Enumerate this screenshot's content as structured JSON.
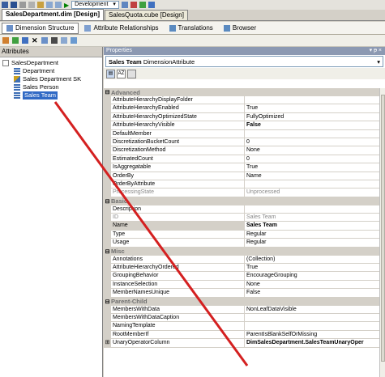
{
  "toolbar": {
    "config_combo": "Development",
    "accent": "#008000"
  },
  "doc_tabs": [
    {
      "label": "SalesDepartment.dim [Design]",
      "active": true
    },
    {
      "label": "SalesQuota.cube [Design]",
      "active": false
    }
  ],
  "design_tabs": [
    {
      "label": "Dimension Structure",
      "active": true
    },
    {
      "label": "Attribute Relationships",
      "active": false
    },
    {
      "label": "Translations",
      "active": false
    },
    {
      "label": "Browser",
      "active": false
    }
  ],
  "attributes_pane": {
    "title": "Attributes",
    "root": "SalesDepartment",
    "items": [
      {
        "label": "Department",
        "selected": false
      },
      {
        "label": "Sales Department SK",
        "selected": false
      },
      {
        "label": "Sales Person",
        "selected": false
      },
      {
        "label": "Sales Team",
        "selected": true
      }
    ]
  },
  "properties": {
    "title": "Properties",
    "pin_glyph": "▾ ᵽ ×",
    "object_name": "Sales Team",
    "object_type": "DimensionAttribute",
    "categories": [
      {
        "name": "Advanced",
        "rows": [
          {
            "name": "AttributeHierarchyDisplayFolder",
            "value": ""
          },
          {
            "name": "AttributeHierarchyEnabled",
            "value": "True"
          },
          {
            "name": "AttributeHierarchyOptimizedState",
            "value": "FullyOptimized"
          },
          {
            "name": "AttributeHierarchyVisible",
            "value": "False",
            "bold": true
          },
          {
            "name": "DefaultMember",
            "value": ""
          },
          {
            "name": "DiscretizationBucketCount",
            "value": "0"
          },
          {
            "name": "DiscretizationMethod",
            "value": "None"
          },
          {
            "name": "EstimatedCount",
            "value": "0"
          },
          {
            "name": "IsAggregatable",
            "value": "True"
          },
          {
            "name": "OrderBy",
            "value": "Name"
          },
          {
            "name": "OrderByAttribute",
            "value": ""
          },
          {
            "name": "ProcessingState",
            "value": "Unprocessed",
            "grey": true
          }
        ]
      },
      {
        "name": "Basic",
        "rows": [
          {
            "name": "Description",
            "value": ""
          },
          {
            "name": "ID",
            "value": "Sales Team",
            "grey": true
          },
          {
            "name": "Name",
            "value": "Sales Team",
            "bold": true,
            "selected": true
          },
          {
            "name": "Type",
            "value": "Regular"
          },
          {
            "name": "Usage",
            "value": "Regular"
          }
        ]
      },
      {
        "name": "Misc",
        "rows": [
          {
            "name": "Annotations",
            "value": "(Collection)"
          },
          {
            "name": "AttributeHierarchyOrdered",
            "value": "True"
          },
          {
            "name": "GroupingBehavior",
            "value": "EncourageGrouping"
          },
          {
            "name": "InstanceSelection",
            "value": "None"
          },
          {
            "name": "MemberNamesUnique",
            "value": "False"
          }
        ]
      },
      {
        "name": "Parent-Child",
        "rows": [
          {
            "name": "MembersWithData",
            "value": "NonLeafDataVisible"
          },
          {
            "name": "MembersWithDataCaption",
            "value": ""
          },
          {
            "name": "NamingTemplate",
            "value": ""
          },
          {
            "name": "RootMemberIf",
            "value": "ParentIsBlankSelfOrMissing"
          },
          {
            "name": "UnaryOperatorColumn",
            "value": "DimSalesDepartment.SalesTeamUnaryOper",
            "bold": true,
            "expander": true
          }
        ]
      }
    ]
  },
  "annotation_color": "#d42020"
}
